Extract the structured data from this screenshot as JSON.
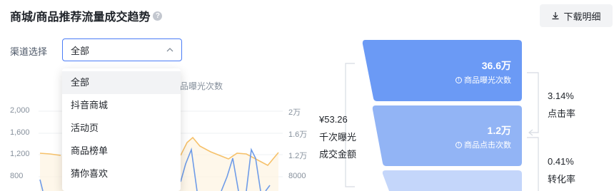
{
  "header": {
    "title": "商城/商品推荐流量成交趋势",
    "help_icon": "?",
    "download_label": "下载明细"
  },
  "filter": {
    "label": "渠道选择",
    "selected": "全部",
    "options": [
      "全部",
      "抖音商城",
      "活动页",
      "商品榜单",
      "猜你喜欢"
    ]
  },
  "chart": {
    "legend_partial": "品曝光次数",
    "y_left_ticks": [
      "2,000",
      "1,600",
      "1,200",
      "800"
    ],
    "y_right_ticks": [
      "2万",
      "1.6万",
      "1.2万",
      "8000"
    ],
    "colors": {
      "line_blue": "#6f9ce8",
      "line_orange": "#f6c16a"
    }
  },
  "funnel": {
    "gmv_value": "¥53.26",
    "gmv_label": "千次曝光成交金额",
    "stages": [
      {
        "value": "36.6万",
        "label": "商品曝光次数",
        "color": "#6b9af5"
      },
      {
        "value": "1.2万",
        "label": "商品点击次数",
        "color": "#92b4f5"
      },
      {
        "value": "",
        "label": "",
        "color": "#c4d6fa"
      }
    ],
    "rates": [
      {
        "value": "3.14%",
        "label": "点击率"
      },
      {
        "value": "0.41%",
        "label": "转化率"
      }
    ]
  }
}
